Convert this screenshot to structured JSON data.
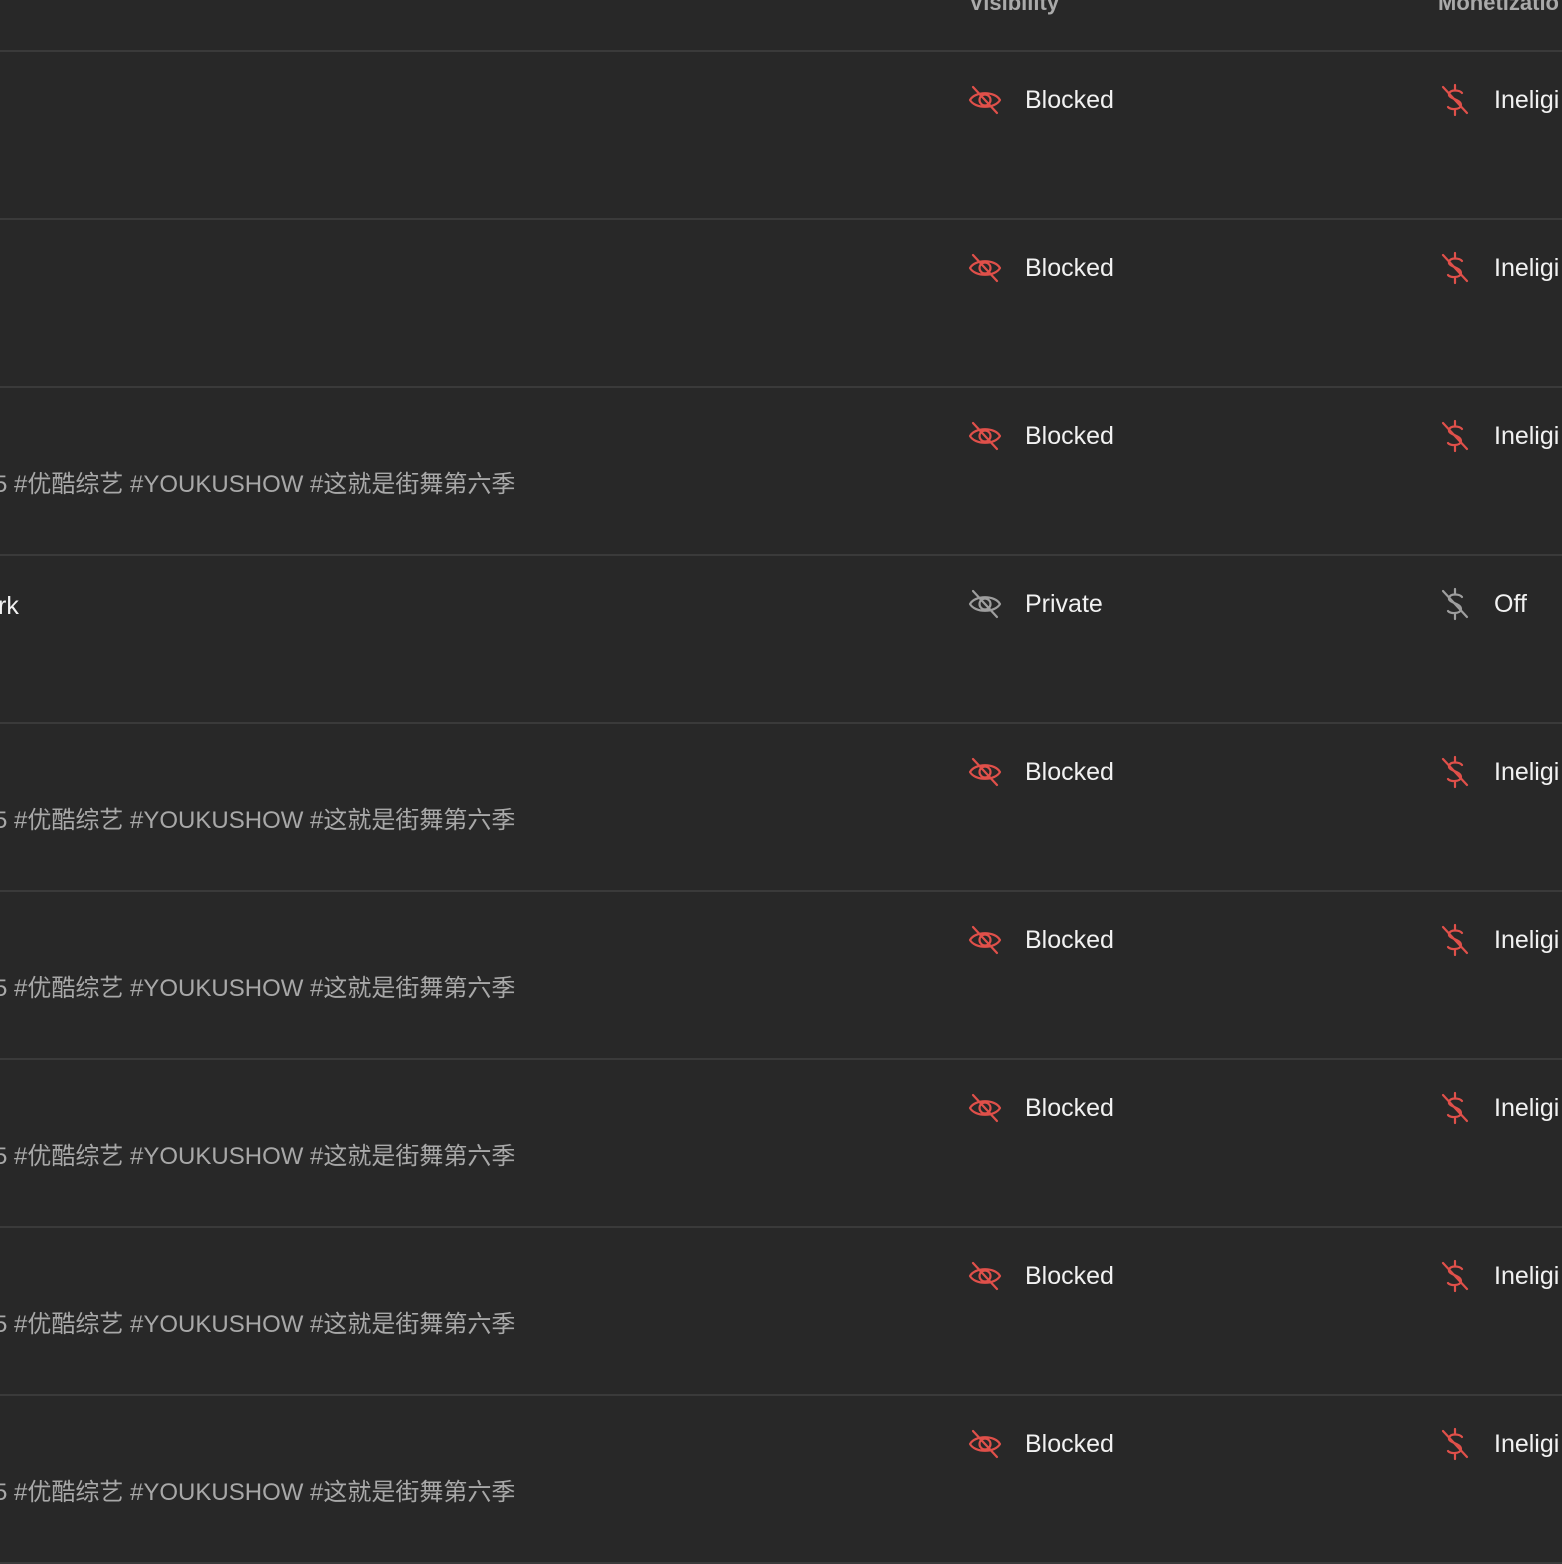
{
  "colors": {
    "background": "#282828",
    "divider": "#3a3a3a",
    "blocked_red": "#e0504a",
    "neutral_gray": "#9e9e9e"
  },
  "headers": {
    "visibility": "Visibility",
    "monetization": "Monetizatio"
  },
  "rows": [
    {
      "title": "",
      "description": "",
      "visibility": "Blocked",
      "visibility_icon": "eye-off-icon",
      "visibility_state": "blocked",
      "monetization": "Ineligi",
      "monetization_icon": "dollar-off-icon",
      "monetization_state": "blocked"
    },
    {
      "title": "",
      "description": "",
      "visibility": "Blocked",
      "visibility_icon": "eye-off-icon",
      "visibility_state": "blocked",
      "monetization": "Ineligi",
      "monetization_icon": "dollar-off-icon",
      "monetization_state": "blocked"
    },
    {
      "title": "",
      "description": "5 #优酷综艺 #YOUKUSHOW #这就是街舞第六季",
      "visibility": "Blocked",
      "visibility_icon": "eye-off-icon",
      "visibility_state": "blocked",
      "monetization": "Ineligi",
      "monetization_icon": "dollar-off-icon",
      "monetization_state": "blocked"
    },
    {
      "title": "rk",
      "description": "",
      "visibility": "Private",
      "visibility_icon": "eye-off-icon",
      "visibility_state": "neutral",
      "monetization": "Off",
      "monetization_icon": "dollar-off-icon",
      "monetization_state": "neutral"
    },
    {
      "title": "",
      "description": "5 #优酷综艺 #YOUKUSHOW #这就是街舞第六季",
      "visibility": "Blocked",
      "visibility_icon": "eye-off-icon",
      "visibility_state": "blocked",
      "monetization": "Ineligi",
      "monetization_icon": "dollar-off-icon",
      "monetization_state": "blocked"
    },
    {
      "title": "",
      "description": "5 #优酷综艺 #YOUKUSHOW #这就是街舞第六季",
      "visibility": "Blocked",
      "visibility_icon": "eye-off-icon",
      "visibility_state": "blocked",
      "monetization": "Ineligi",
      "monetization_icon": "dollar-off-icon",
      "monetization_state": "blocked"
    },
    {
      "title": "",
      "description": "5 #优酷综艺 #YOUKUSHOW #这就是街舞第六季",
      "visibility": "Blocked",
      "visibility_icon": "eye-off-icon",
      "visibility_state": "blocked",
      "monetization": "Ineligi",
      "monetization_icon": "dollar-off-icon",
      "monetization_state": "blocked"
    },
    {
      "title": "",
      "description": "5 #优酷综艺 #YOUKUSHOW #这就是街舞第六季",
      "visibility": "Blocked",
      "visibility_icon": "eye-off-icon",
      "visibility_state": "blocked",
      "monetization": "Ineligi",
      "monetization_icon": "dollar-off-icon",
      "monetization_state": "blocked"
    },
    {
      "title": "",
      "description": "5 #优酷综艺 #YOUKUSHOW #这就是街舞第六季",
      "visibility": "Blocked",
      "visibility_icon": "eye-off-icon",
      "visibility_state": "blocked",
      "monetization": "Ineligi",
      "monetization_icon": "dollar-off-icon",
      "monetization_state": "blocked"
    }
  ]
}
